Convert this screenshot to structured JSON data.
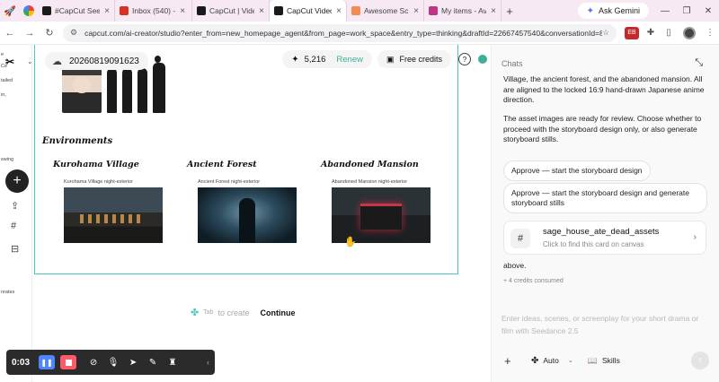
{
  "browser": {
    "tabs": [
      {
        "title": "#CapCut Seed",
        "fav_color": "#1a1a1a",
        "active": false
      },
      {
        "title": "Inbox (540) -",
        "fav_color": "#d93025",
        "active": false
      },
      {
        "title": "CapCut | Vide",
        "fav_color": "#1a1a1a",
        "active": false
      },
      {
        "title": "CapCut Video",
        "fav_color": "#1a1a1a",
        "active": true
      },
      {
        "title": "Awesome Scr",
        "fav_color": "#f28b54",
        "active": false
      },
      {
        "title": "My items - Av",
        "fav_color": "#c13584",
        "active": false
      }
    ],
    "tab_close": "×",
    "new_tab": "+",
    "ask_gemini": "Ask Gemini",
    "url": "capcut.com/ai-creator/studio?enter_from=new_homepage_agent&from_page=work_space&entry_type=thinking&draftId=22667457540&conversationId=8a5...",
    "ext_badge": "EB"
  },
  "rail": {
    "texts": [
      "e",
      "Ce",
      "tailed",
      "in,",
      "swing",
      "nrates"
    ]
  },
  "header": {
    "project_id": "20260819091623",
    "credits": "5,216",
    "renew": "Renew",
    "free_credits": "Free credits"
  },
  "canvas": {
    "environments_title": "Environments",
    "environments": [
      {
        "name": "Kurohama Village",
        "caption": "Kurohama Village night-exterior"
      },
      {
        "name": "Ancient Forest",
        "caption": "Ancient Forest night-exterior"
      },
      {
        "name": "Abandoned Mansion",
        "caption": "Abandoned Mansion night-exterior"
      }
    ],
    "tab_key": "Tab",
    "to_create": "to create",
    "continue": "Continue"
  },
  "recorder": {
    "time": "0:03"
  },
  "chats": {
    "title": "Chats",
    "message_1": "Village, the ancient forest, and the abandoned mansion. All are aligned to the locked 16:9 hand-drawn Japanese anime direction.",
    "message_2": "The asset images are ready for review. Choose whether to proceed with the storyboard design only, or also generate storyboard stills.",
    "option_1": "Approve — start the storyboard design",
    "option_2": "Approve — start the storyboard design and generate storyboard stills",
    "asset_card": {
      "name": "sage_house_ate_dead_assets",
      "description": "Click to find this card on canvas"
    },
    "above": "above.",
    "credits_consumed": "4 credits consumed",
    "composer_placeholder": "Enter ideas, scenes, or screenplay for your short drama or film with Seedance 2.5",
    "mode": "Auto",
    "skills": "Skills"
  }
}
